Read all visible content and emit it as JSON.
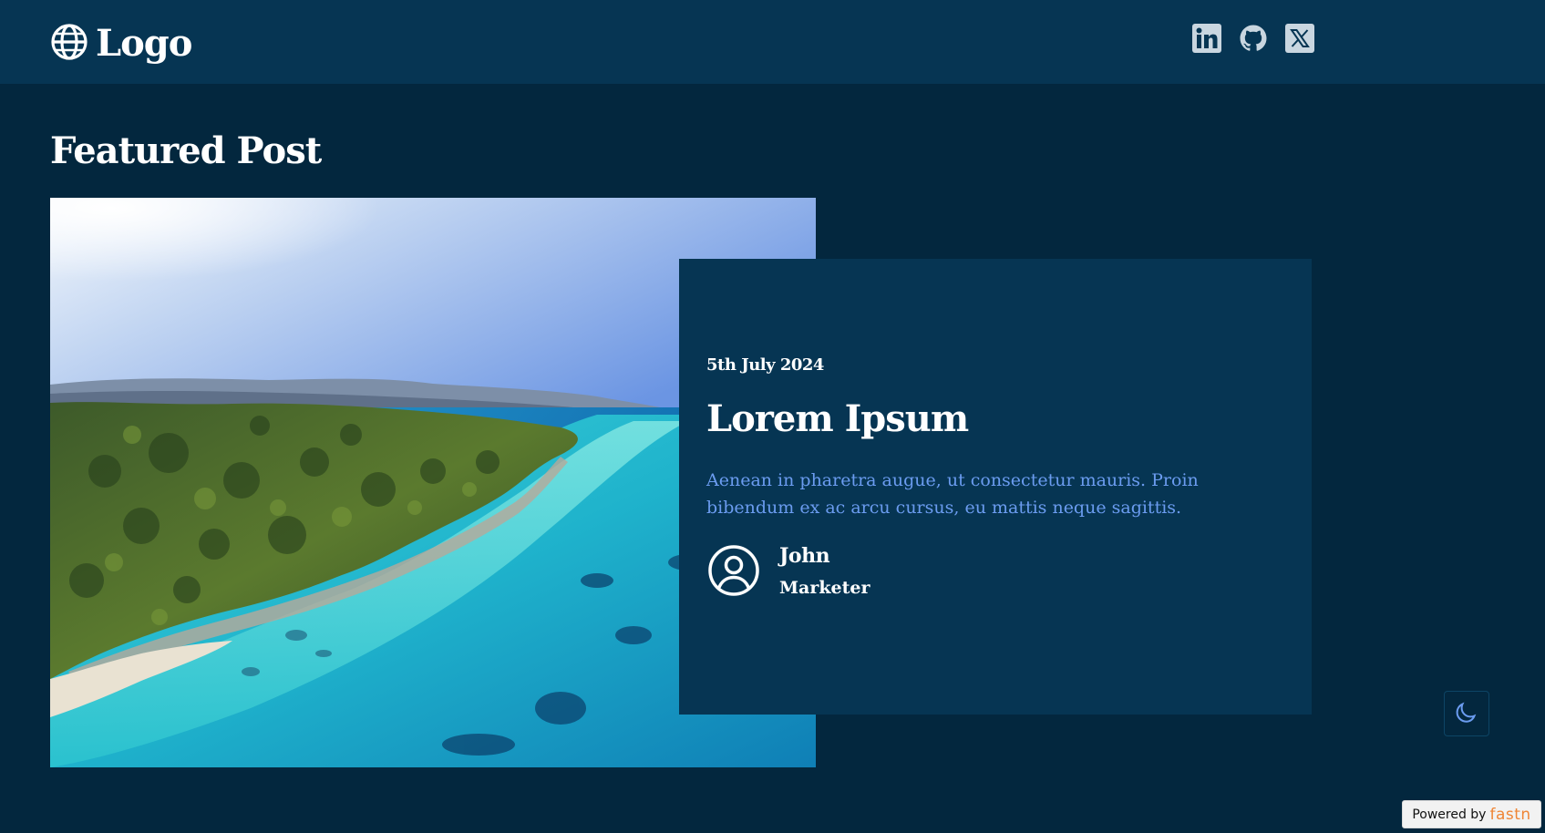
{
  "header": {
    "logo_text": "Logo",
    "logo_icon": "globe-icon",
    "social_links": [
      {
        "name": "linkedin-icon"
      },
      {
        "name": "github-icon"
      },
      {
        "name": "x-twitter-icon"
      }
    ]
  },
  "featured": {
    "section_title": "Featured Post",
    "image_description_icon": "image",
    "post": {
      "date": "5th July 2024",
      "title": "Lorem Ipsum",
      "excerpt": "Aenean in pharetra augue, ut consectetur mauris. Proin bibendum ex ac arcu cursus, eu mattis neque sagittis.",
      "author": {
        "name": "John",
        "role": "Marketer",
        "avatar_icon": "user-circle-icon"
      }
    }
  },
  "theme_toggle": {
    "icon": "moon-icon"
  },
  "powered_by": {
    "prefix": "Powered by",
    "brand": "fastn"
  },
  "colors": {
    "background": "#03273e",
    "header_background": "#063553",
    "card_background": "#063553",
    "excerpt_text": "#6b9cf0",
    "brand_accent": "#ef8535",
    "moon_icon": "#6b9cf0"
  }
}
